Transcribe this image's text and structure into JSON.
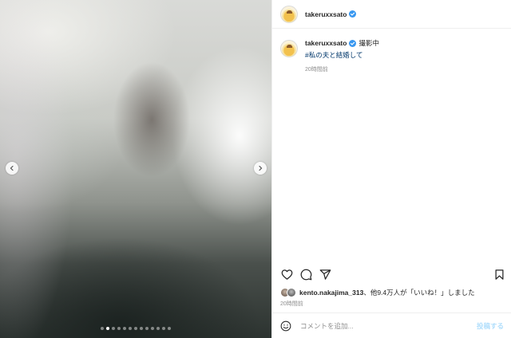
{
  "post_image": {
    "slide_count": 13,
    "active_slide": 2
  },
  "header": {
    "username": "takeruxxsato"
  },
  "caption": {
    "username": "takeruxxsato",
    "text": "撮影中",
    "hashtag": "#私の夫と結婚して",
    "time": "20時間前"
  },
  "likes": {
    "user": "kento.nakajima_313",
    "rest": "、他9.4万人が「いいね！」しました"
  },
  "post_time": "20時間前",
  "comment": {
    "placeholder": "コメントを追加...",
    "post_label": "投稿する"
  },
  "icons": [
    "chevron-left-icon",
    "chevron-right-icon",
    "verified-icon",
    "heart-icon",
    "comment-icon",
    "share-icon",
    "bookmark-icon",
    "emoji-icon"
  ],
  "colors": {
    "verified": "#3897f0",
    "hashtag": "#00376b",
    "post_button": "#b2dffc",
    "muted": "#8e8e8e"
  }
}
